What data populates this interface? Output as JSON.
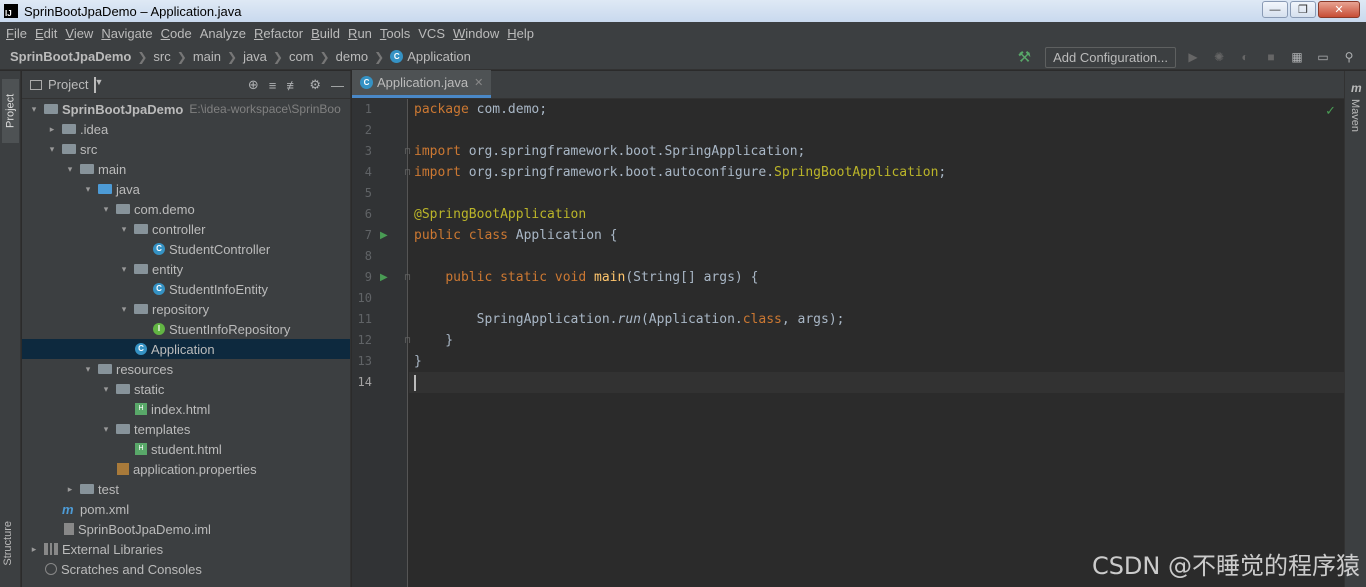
{
  "window": {
    "title": "SprinBootJpaDemo – Application.java"
  },
  "menu": [
    {
      "mn": "F",
      "rest": "ile"
    },
    {
      "mn": "E",
      "rest": "dit"
    },
    {
      "mn": "V",
      "rest": "iew"
    },
    {
      "mn": "N",
      "rest": "avigate"
    },
    {
      "mn": "C",
      "rest": "ode"
    },
    {
      "mn": "",
      "rest": "Analyze"
    },
    {
      "mn": "R",
      "rest": "efactor"
    },
    {
      "mn": "B",
      "rest": "uild"
    },
    {
      "mn": "R",
      "rest": "un",
      "pre": ""
    },
    {
      "mn": "T",
      "rest": "ools"
    },
    {
      "mn": "",
      "rest": "VCS"
    },
    {
      "mn": "W",
      "rest": "indow"
    },
    {
      "mn": "H",
      "rest": "elp"
    }
  ],
  "breadcrumb": [
    "SprinBootJpaDemo",
    "src",
    "main",
    "java",
    "com",
    "demo",
    "Application"
  ],
  "toolbar": {
    "add_config": "Add Configuration..."
  },
  "sidebar": {
    "project_tab": "Project",
    "structure_tab": "Structure"
  },
  "right_strip": {
    "maven_tab": "Maven"
  },
  "project_panel": {
    "title": "Project",
    "tree": [
      {
        "depth": 0,
        "arrow": "down",
        "icon": "proj",
        "label": "SprinBootJpaDemo",
        "bold": true,
        "path": "E:\\idea-workspace\\SprinBoo"
      },
      {
        "depth": 1,
        "arrow": "right",
        "icon": "fold",
        "label": ".idea"
      },
      {
        "depth": 1,
        "arrow": "down",
        "icon": "fold",
        "label": "src"
      },
      {
        "depth": 2,
        "arrow": "down",
        "icon": "fold",
        "label": "main"
      },
      {
        "depth": 3,
        "arrow": "down",
        "icon": "fold-blue",
        "label": "java"
      },
      {
        "depth": 4,
        "arrow": "down",
        "icon": "pkg",
        "label": "com.demo"
      },
      {
        "depth": 5,
        "arrow": "down",
        "icon": "pkg",
        "label": "controller"
      },
      {
        "depth": 6,
        "arrow": "",
        "icon": "class",
        "label": "StudentController"
      },
      {
        "depth": 5,
        "arrow": "down",
        "icon": "pkg",
        "label": "entity"
      },
      {
        "depth": 6,
        "arrow": "",
        "icon": "class",
        "label": "StudentInfoEntity"
      },
      {
        "depth": 5,
        "arrow": "down",
        "icon": "pkg",
        "label": "repository"
      },
      {
        "depth": 6,
        "arrow": "",
        "icon": "iface",
        "label": "StuentInfoRepository"
      },
      {
        "depth": 5,
        "arrow": "",
        "icon": "boot",
        "label": "Application",
        "selected": true
      },
      {
        "depth": 3,
        "arrow": "down",
        "icon": "fold",
        "label": "resources"
      },
      {
        "depth": 4,
        "arrow": "down",
        "icon": "fold",
        "label": "static"
      },
      {
        "depth": 5,
        "arrow": "",
        "icon": "html",
        "label": "index.html"
      },
      {
        "depth": 4,
        "arrow": "down",
        "icon": "fold",
        "label": "templates"
      },
      {
        "depth": 5,
        "arrow": "",
        "icon": "html",
        "label": "student.html"
      },
      {
        "depth": 4,
        "arrow": "",
        "icon": "props",
        "label": "application.properties"
      },
      {
        "depth": 2,
        "arrow": "right",
        "icon": "fold",
        "label": "test"
      },
      {
        "depth": 1,
        "arrow": "",
        "icon": "maven",
        "label": "pom.xml"
      },
      {
        "depth": 1,
        "arrow": "",
        "icon": "iml",
        "label": "SprinBootJpaDemo.iml"
      },
      {
        "depth": 0,
        "arrow": "right",
        "icon": "lib",
        "label": "External Libraries"
      },
      {
        "depth": 0,
        "arrow": "",
        "icon": "scratch",
        "label": "Scratches and Consoles"
      }
    ]
  },
  "editor": {
    "tab_label": "Application.java",
    "current_line": 14,
    "lines": [
      {
        "n": "1",
        "html": "<span class='kw'>package</span> com.demo;"
      },
      {
        "n": "2",
        "html": ""
      },
      {
        "n": "3",
        "html": "<span class='kw'>import</span> org.springframework.boot.SpringApplication;",
        "fold": true
      },
      {
        "n": "4",
        "html": "<span class='kw'>import</span> org.springframework.boot.autoconfigure.<span class='ann'>SpringBootApplication</span>;",
        "fold": true
      },
      {
        "n": "5",
        "html": ""
      },
      {
        "n": "6",
        "html": "<span class='ann'>@SpringBootApplication</span>"
      },
      {
        "n": "7",
        "html": "<span class='kw'>public class</span> Application {",
        "run": true
      },
      {
        "n": "8",
        "html": ""
      },
      {
        "n": "9",
        "html": "    <span class='kw'>public static void</span> <span class='fn'>main</span>(String[] args) {",
        "run": true,
        "fold": true
      },
      {
        "n": "10",
        "html": ""
      },
      {
        "n": "11",
        "html": "        SpringApplication.<span class='it'>run</span>(Application.<span class='kw'>class</span>, args);"
      },
      {
        "n": "12",
        "html": "    }",
        "fold": true
      },
      {
        "n": "13",
        "html": "}"
      },
      {
        "n": "14",
        "html": "<span class='caret'></span>"
      }
    ]
  },
  "watermark": "CSDN @不睡觉的程序猿"
}
